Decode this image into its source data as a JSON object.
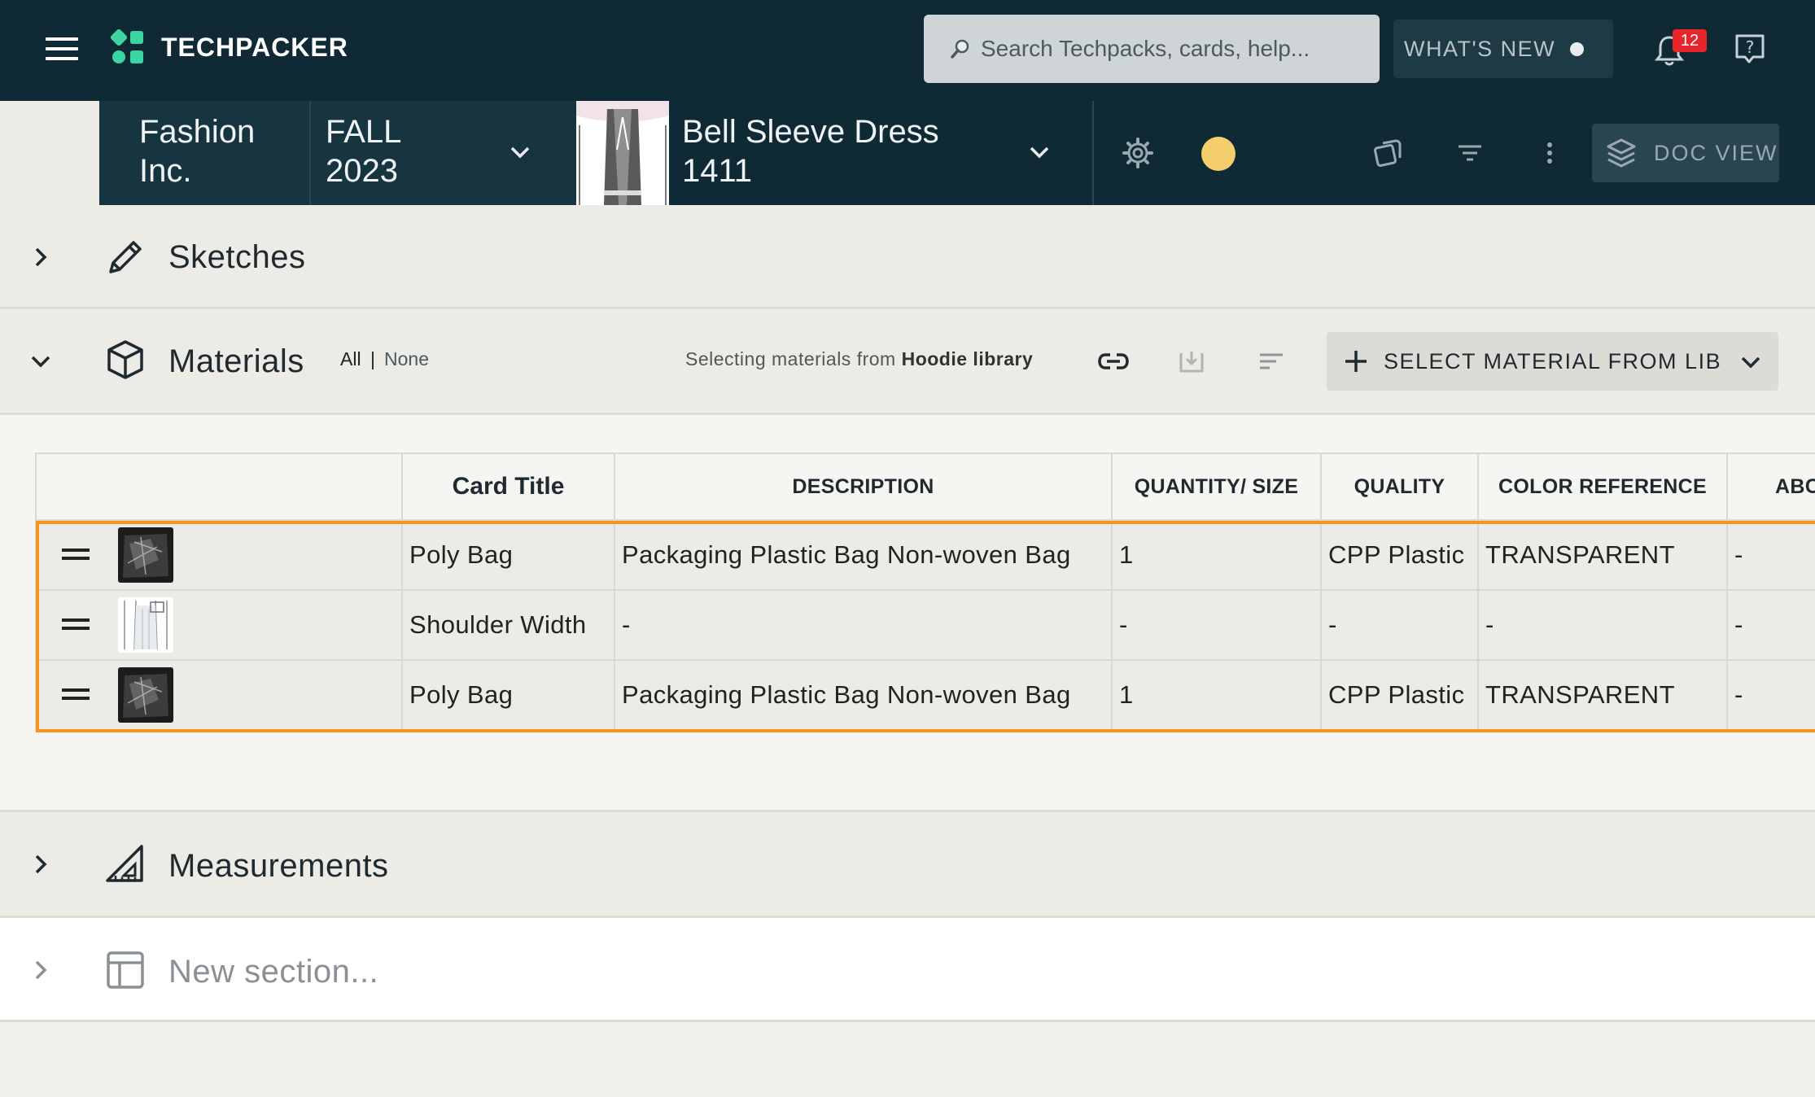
{
  "app": {
    "brand": "TECHPACKER",
    "search_placeholder": "Search Techpacks, cards, help...",
    "whats_new": "WHAT'S NEW",
    "notification_count": "12",
    "colors": {
      "header_bg": "#0f2a35",
      "accent_orange": "#f7931e",
      "status_yellow": "#f5cf6b",
      "badge_red": "#e8252a",
      "logo_green": "#3dd6a3"
    }
  },
  "context": {
    "company": "Fashion Inc.",
    "season": "FALL 2023",
    "product": "Bell Sleeve Dress 1411",
    "doc_view": "DOC VIEW"
  },
  "sections": {
    "sketches": {
      "title": "Sketches"
    },
    "materials": {
      "title": "Materials",
      "select_all": "All",
      "separator": "|",
      "select_none": "None",
      "library_prefix": "Selecting materials from",
      "library_name": "Hoodie library",
      "select_button": "SELECT MATERIAL FROM LIB",
      "columns": [
        "Card Title",
        "DESCRIPTION",
        "QUANTITY/ SIZE",
        "QUALITY",
        "COLOR REFERENCE",
        "ABC"
      ],
      "rows": [
        {
          "card_title": "Poly Bag",
          "description": "Packaging Plastic Bag Non-woven Bag",
          "quantity": "1",
          "quality": "CPP Plastic",
          "color_reference": "TRANSPARENT",
          "abc": "-"
        },
        {
          "card_title": "Shoulder Width",
          "description": "-",
          "quantity": "-",
          "quality": "-",
          "color_reference": "-",
          "abc": "-"
        },
        {
          "card_title": "Poly Bag",
          "description": "Packaging Plastic Bag Non-woven Bag",
          "quantity": "1",
          "quality": "CPP Plastic",
          "color_reference": "TRANSPARENT",
          "abc": "-"
        }
      ]
    },
    "measurements": {
      "title": "Measurements"
    },
    "new_section": {
      "placeholder": "New section..."
    }
  }
}
